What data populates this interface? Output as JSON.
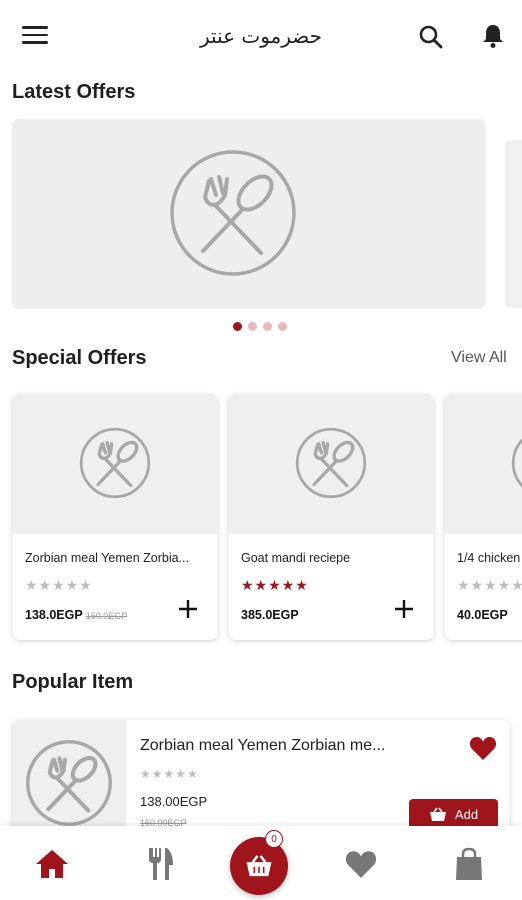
{
  "header": {
    "title": "حضرموت عنتر",
    "menu_icon": "menu-icon",
    "search_icon": "search-icon",
    "bell_icon": "bell-icon"
  },
  "sections": {
    "latest_offers": "Latest Offers",
    "special_offers": "Special Offers",
    "view_all": "View All",
    "popular_item": "Popular Item"
  },
  "carousel": {
    "pages": 4,
    "active_page": 1
  },
  "special_offers": [
    {
      "name": "Zorbian meal Yemen Zorbia...",
      "stars": "★★★★★",
      "rating": 0,
      "price": "138.0EGP",
      "old_price": "150.0EGP"
    },
    {
      "name": "Goat mandi reciepe",
      "stars": "★★★★★",
      "rating": 5,
      "price": "385.0EGP",
      "old_price": ""
    },
    {
      "name": "1/4 chicken",
      "stars": "★★★★★",
      "rating": 0,
      "price": "40.0EGP",
      "old_price": ""
    }
  ],
  "popular": {
    "name": "Zorbian meal Yemen Zorbian me...",
    "stars": "★★★★★",
    "rating": 0,
    "price": "138.00EGP",
    "old_price": "150.00EGP",
    "add_label": "Add",
    "favorite": true
  },
  "bottom_nav": {
    "home_icon": "home-icon",
    "menu_icon": "fork-knife-icon",
    "cart_icon": "basket-icon",
    "cart_count": "0",
    "favorites_icon": "heart-icon",
    "bag_icon": "shopping-bag-icon"
  },
  "colors": {
    "accent": "#a0141c",
    "placeholder": "#efefef",
    "star_inactive": "#bdbdbd"
  }
}
